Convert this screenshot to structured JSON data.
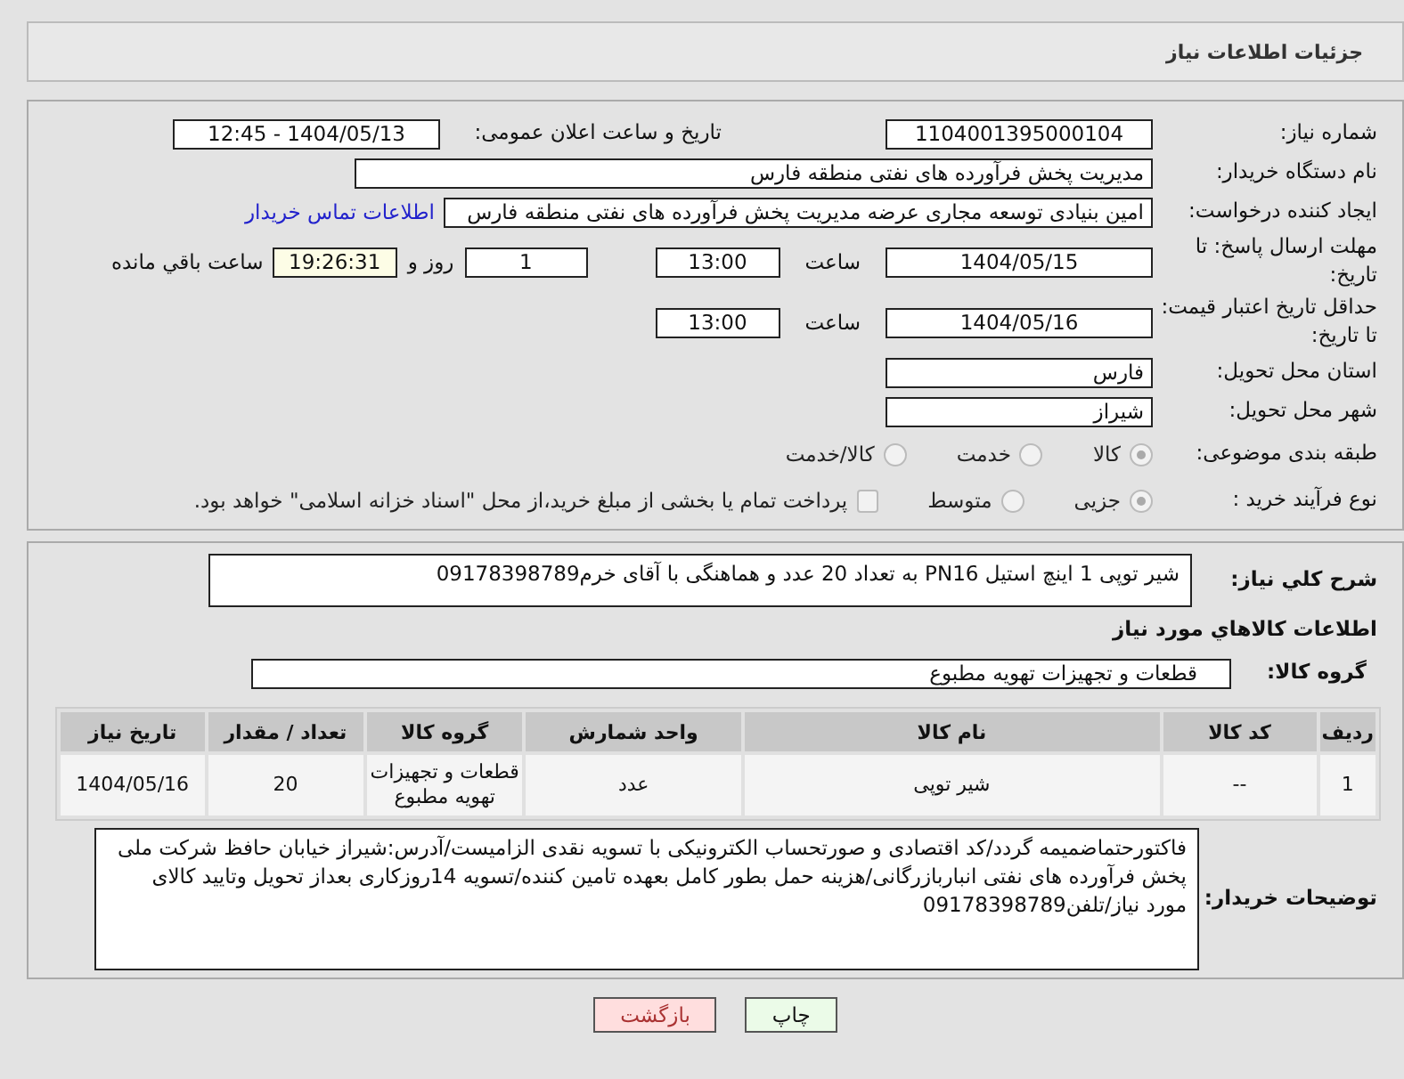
{
  "header": {
    "title": "جزئیات اطلاعات نیاز"
  },
  "need_number": {
    "label": "شماره نیاز:",
    "value": "1104001395000104"
  },
  "announce": {
    "label": "تاریخ و ساعت اعلان عمومی:",
    "value": "1404/05/13 - 12:45"
  },
  "buyer_org": {
    "label": "نام دستگاه خریدار:",
    "value": "مدیریت پخش فرآورده های نفتی منطقه فارس"
  },
  "requester": {
    "label": "ایجاد کننده درخواست:",
    "value": "امین بنیادی توسعه مجاری عرضه مدیریت پخش فرآورده های نفتی منطقه فارس",
    "link": "اطلاعات تماس خریدار"
  },
  "deadline": {
    "label": "مهلت ارسال پاسخ: تا تاریخ:",
    "date": "1404/05/15",
    "time_label": "ساعت",
    "time": "13:00",
    "days": "1",
    "days_label": "روز و",
    "remaining": "19:26:31",
    "remaining_label": "ساعت باقي مانده"
  },
  "validity": {
    "label": "حداقل تاریخ اعتبار قیمت: تا تاریخ:",
    "date": "1404/05/16",
    "time_label": "ساعت",
    "time": "13:00"
  },
  "province": {
    "label": "استان محل تحویل:",
    "value": "فارس"
  },
  "city": {
    "label": "شهر محل تحویل:",
    "value": "شیراز"
  },
  "category": {
    "label": "طبقه بندی موضوعی:",
    "options": [
      {
        "label": "کالا",
        "selected": true
      },
      {
        "label": "خدمت",
        "selected": false
      },
      {
        "label": "کالا/خدمت",
        "selected": false
      }
    ]
  },
  "process": {
    "label": "نوع فرآیند خرید :",
    "options": [
      {
        "label": "جزیی",
        "selected": true
      },
      {
        "label": "متوسط",
        "selected": false
      }
    ],
    "treasury": {
      "label": "پرداخت تمام یا بخشی از مبلغ خرید،از محل \"اسناد خزانه اسلامی\" خواهد بود.",
      "checked": false
    }
  },
  "description": {
    "label": "شرح کلي نياز:",
    "value": "شیر توپی 1 اینچ استیل PN16 به تعداد 20 عدد و هماهنگی با آقای خرم09178398789"
  },
  "goods_title": "اطلاعات کالاهاي مورد نياز",
  "group": {
    "label": "گروه کالا:",
    "value": "قطعات و تجهیزات تهویه مطبوع"
  },
  "table": {
    "columns": [
      "ردیف",
      "کد کالا",
      "نام کالا",
      "واحد شمارش",
      "گروه کالا",
      "تعداد / مقدار",
      "تاریخ نیاز"
    ],
    "rows": [
      [
        "1",
        "--",
        "شیر توپی",
        "عدد",
        "قطعات و تجهیزات تهویه مطبوع",
        "20",
        "1404/05/16"
      ]
    ]
  },
  "buyer_notes": {
    "label": "توضیحات خریدار:",
    "value": "فاکتورحتماضمیمه گردد/کد اقتصادی و صورتحساب الکترونیکی با تسویه نقدی الزامیست/آدرس:شیراز خیابان حافظ شرکت ملی پخش فرآورده های نفتی انباربازرگانی/هزینه حمل بطور کامل بعهده تامین کننده/تسویه 14روزکاری بعداز تحویل وتایید کالای مورد نیاز/تلفن09178398789"
  },
  "buttons": [
    {
      "label": "چاپ",
      "kind": "print"
    },
    {
      "label": "بازگشت",
      "kind": "back"
    }
  ]
}
